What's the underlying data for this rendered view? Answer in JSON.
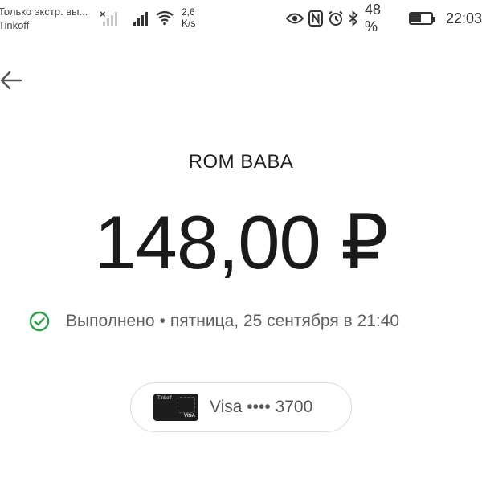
{
  "status_bar": {
    "notification_title": "Только экстр. вы...",
    "notification_sub": "Tinkoff",
    "network_speed_value": "2,6",
    "network_speed_unit": "K/s",
    "battery_percent": "48 %",
    "battery_level": 0.48,
    "time": "22:03"
  },
  "payment": {
    "merchant": "ROM BABA",
    "amount": "148,00 ₽",
    "status": "Выполнено",
    "separator": "•",
    "date": "пятница, 25 сентября в 21:40",
    "status_color": "#2e9e4a"
  },
  "card": {
    "brand_text": "Tinkoff",
    "mini_network": "VISA",
    "label": "Visa •••• 3700"
  }
}
